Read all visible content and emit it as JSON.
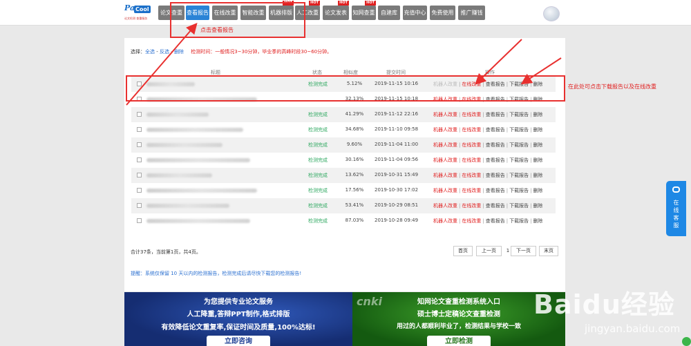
{
  "logo": {
    "word1": "Paper",
    "word2": "Cool",
    "tagline": "论文检测 查重服务"
  },
  "nav": {
    "items": [
      {
        "label": "论文查重",
        "hot": ""
      },
      {
        "label": "查看报告",
        "hot": ""
      },
      {
        "label": "在线改重",
        "hot": ""
      },
      {
        "label": "智能改重",
        "hot": ""
      },
      {
        "label": "机器排版",
        "hot": "HOT"
      },
      {
        "label": "人工改重",
        "hot": "HOT"
      },
      {
        "label": "论文发表",
        "hot": "HOT"
      },
      {
        "label": "知网查重",
        "hot": "HOT"
      },
      {
        "label": "自建库",
        "hot": ""
      },
      {
        "label": "充值中心",
        "hot": ""
      },
      {
        "label": "免费使用",
        "hot": ""
      },
      {
        "label": "推广赚钱",
        "hot": ""
      }
    ]
  },
  "toolbar": {
    "select_label": "选择：",
    "select_all": "全选",
    "select_sep1": " - ",
    "invert": "反选",
    "select_sep2": " - ",
    "delete": "删除",
    "notice": "检测时间：一般情况3~30分钟，毕业季的高峰时段30~60分钟。"
  },
  "table": {
    "headers": {
      "title": "标题",
      "status": "状态",
      "similarity": "相似度",
      "time": "提交时间",
      "ops": "操作"
    },
    "ops": {
      "robot": "机器人改重",
      "online": "在线改重",
      "view": "查看报告",
      "download": "下载报告",
      "delete": "删除"
    },
    "rows": [
      {
        "status": "检测完成",
        "similarity": "5.12%",
        "time": "2019-11-15 10:16"
      },
      {
        "status": "",
        "similarity": "32.13%",
        "time": "2019-11-15 10:18"
      },
      {
        "status": "检测完成",
        "similarity": "41.29%",
        "time": "2019-11-12 22:16"
      },
      {
        "status": "检测完成",
        "similarity": "34.68%",
        "time": "2019-11-10 09:58"
      },
      {
        "status": "检测完成",
        "similarity": "9.60%",
        "time": "2019-11-04 11:00"
      },
      {
        "status": "检测完成",
        "similarity": "30.16%",
        "time": "2019-11-04 09:56"
      },
      {
        "status": "检测完成",
        "similarity": "13.62%",
        "time": "2019-10-31 15:49"
      },
      {
        "status": "检测完成",
        "similarity": "17.56%",
        "time": "2019-10-30 17:02"
      },
      {
        "status": "检测完成",
        "similarity": "53.41%",
        "time": "2019-10-29 08:51"
      },
      {
        "status": "检测完成",
        "similarity": "87.03%",
        "time": "2019-10-28 09:49"
      }
    ]
  },
  "pagination": {
    "summary": "合计37条，当前第1页，共4页。",
    "first": "首页",
    "prev": "上一页",
    "current": "1",
    "next": "下一页",
    "last": "末页"
  },
  "tip": "提醒：系统仅保留 10 天以内的检测报告，检测完成后请尽快下载您的检测报告!",
  "annotations": {
    "click_view": "点击查看报告",
    "click_download": "在此处可点击下载报告以及在线改重"
  },
  "banner_left": {
    "line1": "为您提供专业论文服务",
    "line2": "人工降重,答辩PPT制作,格式排版",
    "line3": "有效降低论文重复率,保证时间及质量,100%达标!",
    "button": "立即咨询"
  },
  "banner_right": {
    "brand": "cnki",
    "line1": "知网论文查重检测系统入口",
    "line2": "硕士博士定稿论文查重检测",
    "line3": "用过的人都顺利毕业了，检测结果与学校一致",
    "button": "立即检测"
  },
  "side_service": {
    "label": "在线客服"
  },
  "watermark": {
    "main": "Baidu经验",
    "sub": "jingyan.baidu.com"
  },
  "colors": {
    "nav_gray": "#7a7a7a",
    "nav_active": "#2a83d6",
    "status_ok": "#2ea860",
    "alert_red": "#e02020",
    "link_blue": "#2a6fd0"
  }
}
